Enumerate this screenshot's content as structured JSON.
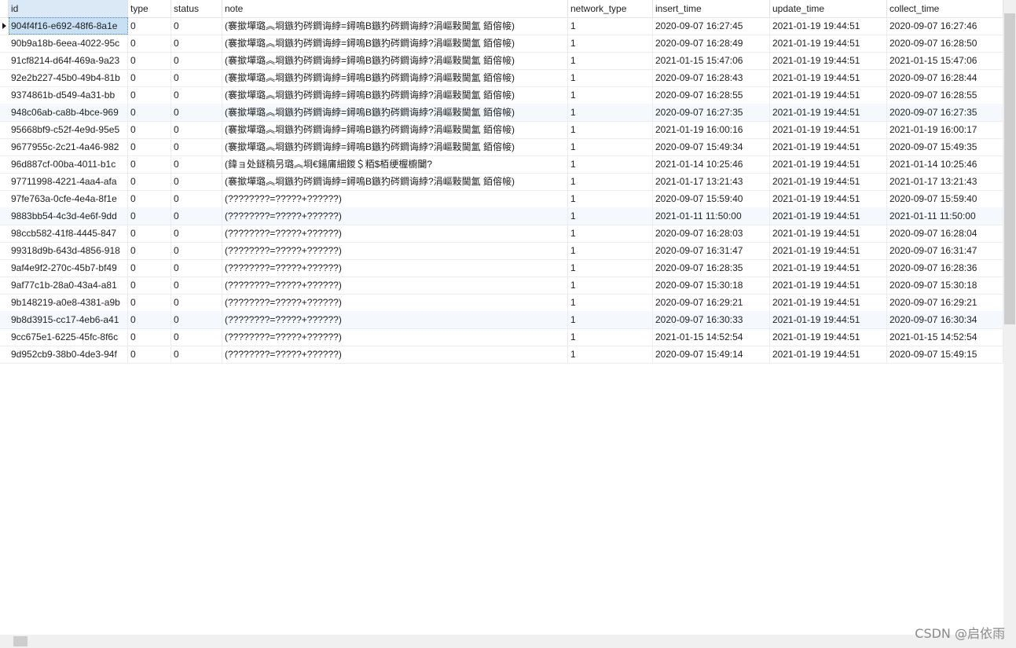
{
  "columns": [
    "id",
    "type",
    "status",
    "note",
    "network_type",
    "insert_time",
    "update_time",
    "collect_time"
  ],
  "rows": [
    [
      "904f4f16-e692-48f6-8a1e",
      "0",
      "0",
      "(褰撳墠璐︽埛鏃犳硶鐧诲綍=鐞嗚В鏃犳硶鐧诲綍?涓嶇敤閫氳 銆傛帹)",
      "1",
      "2020-09-07 16:27:45",
      "2021-01-19 19:44:51",
      "2020-09-07 16:27:46"
    ],
    [
      "90b9a18b-6eea-4022-95c",
      "0",
      "0",
      "(褰撳墠璐︽埛鏃犳硶鐧诲綍=鐞嗚В鏃犳硶鐧诲綍?涓嶇敤閫氳 銆傛帹)",
      "1",
      "2020-09-07 16:28:49",
      "2021-01-19 19:44:51",
      "2020-09-07 16:28:50"
    ],
    [
      "91cf8214-d64f-469a-9a23",
      "0",
      "0",
      "(褰撳墠璐︽埛鏃犳硶鐧诲綍=鐞嗚В鏃犳硶鐧诲綍?涓嶇敤閫氳 銆傛帹)",
      "1",
      "2021-01-15 15:47:06",
      "2021-01-19 19:44:51",
      "2021-01-15 15:47:06"
    ],
    [
      "92e2b227-45b0-49b4-81b",
      "0",
      "0",
      "(褰撳墠璐︽埛鏃犳硶鐧诲綍=鐞嗚В鏃犳硶鐧诲綍?涓嶇敤閫氳 銆傛帹)",
      "1",
      "2020-09-07 16:28:43",
      "2021-01-19 19:44:51",
      "2020-09-07 16:28:44"
    ],
    [
      "9374861b-d549-4a31-bb",
      "0",
      "0",
      "(褰撳墠璐︽埛鏃犳硶鐧诲綍=鐞嗚В鏃犳硶鐧诲綍?涓嶇敤閫氳 銆傛帹)",
      "1",
      "2020-09-07 16:28:55",
      "2021-01-19 19:44:51",
      "2020-09-07 16:28:55"
    ],
    [
      "948c06ab-ca8b-4bce-969",
      "0",
      "0",
      "(褰撳墠璐︽埛鏃犳硶鐧诲綍=鐞嗚В鏃犳硶鐧诲綍?涓嶇敤閫氳 銆傛帹)",
      "1",
      "2020-09-07 16:27:35",
      "2021-01-19 19:44:51",
      "2020-09-07 16:27:35"
    ],
    [
      "95668bf9-c52f-4e9d-95e5",
      "0",
      "0",
      "(褰撳墠璐︽埛鏃犳硶鐧诲綍=鐞嗚В鏃犳硶鐧诲綍?涓嶇敤閫氳 銆傛帹)",
      "1",
      "2021-01-19 16:00:16",
      "2021-01-19 19:44:51",
      "2021-01-19 16:00:17"
    ],
    [
      "9677955c-2c21-4a46-982",
      "0",
      "0",
      "(褰撳墠璐︽埛鏃犳硶鐧诲綍=鐞嗚В鏃犳硶鐧诲綍?涓嶇敤閫氳 銆傛帹)",
      "1",
      "2020-09-07 15:49:34",
      "2021-01-19 19:44:51",
      "2020-09-07 15:49:35"
    ],
    [
      "96d887cf-00ba-4011-b1c",
      "0",
      "0",
      "(鍏ョ处鐩稿叧璐︽埛€鍚庯細鍐＄粨$栢绠楃櫥闄?",
      "1",
      "2021-01-14 10:25:46",
      "2021-01-19 19:44:51",
      "2021-01-14 10:25:46"
    ],
    [
      "97711998-4221-4aa4-afa",
      "0",
      "0",
      "(褰撳墠璐︽埛鏃犳硶鐧诲綍=鐞嗚В鏃犳硶鐧诲綍?涓嶇敤閫氳 銆傛帹)",
      "1",
      "2021-01-17 13:21:43",
      "2021-01-19 19:44:51",
      "2021-01-17 13:21:43"
    ],
    [
      "97fe763a-0cfe-4e4a-8f1e",
      "0",
      "0",
      "(????????=?????+??????)",
      "1",
      "2020-09-07 15:59:40",
      "2021-01-19 19:44:51",
      "2020-09-07 15:59:40"
    ],
    [
      "9883bb54-4c3d-4e6f-9dd",
      "0",
      "0",
      "(????????=?????+??????)",
      "1",
      "2021-01-11 11:50:00",
      "2021-01-19 19:44:51",
      "2021-01-11 11:50:00"
    ],
    [
      "98ccb582-41f8-4445-847",
      "0",
      "0",
      "(????????=?????+??????)",
      "1",
      "2020-09-07 16:28:03",
      "2021-01-19 19:44:51",
      "2020-09-07 16:28:04"
    ],
    [
      "99318d9b-643d-4856-918",
      "0",
      "0",
      "(????????=?????+??????)",
      "1",
      "2020-09-07 16:31:47",
      "2021-01-19 19:44:51",
      "2020-09-07 16:31:47"
    ],
    [
      "9af4e9f2-270c-45b7-bf49",
      "0",
      "0",
      "(????????=?????+??????)",
      "1",
      "2020-09-07 16:28:35",
      "2021-01-19 19:44:51",
      "2020-09-07 16:28:36"
    ],
    [
      "9af77c1b-28a0-43a4-a81",
      "0",
      "0",
      "(????????=?????+??????)",
      "1",
      "2020-09-07 15:30:18",
      "2021-01-19 19:44:51",
      "2020-09-07 15:30:18"
    ],
    [
      "9b148219-a0e8-4381-a9b",
      "0",
      "0",
      "(????????=?????+??????)",
      "1",
      "2020-09-07 16:29:21",
      "2021-01-19 19:44:51",
      "2020-09-07 16:29:21"
    ],
    [
      "9b8d3915-cc17-4eb6-a41",
      "0",
      "0",
      "(????????=?????+??????)",
      "1",
      "2020-09-07 16:30:33",
      "2021-01-19 19:44:51",
      "2020-09-07 16:30:34"
    ],
    [
      "9cc675e1-6225-45fc-8f6c",
      "0",
      "0",
      "(????????=?????+??????)",
      "1",
      "2021-01-15 14:52:54",
      "2021-01-19 19:44:51",
      "2021-01-15 14:52:54"
    ],
    [
      "9d952cb9-38b0-4de3-94f",
      "0",
      "0",
      "(????????=?????+??????)",
      "1",
      "2020-09-07 15:49:14",
      "2021-01-19 19:44:51",
      "2020-09-07 15:49:15"
    ]
  ],
  "watermark": "CSDN @启依雨"
}
